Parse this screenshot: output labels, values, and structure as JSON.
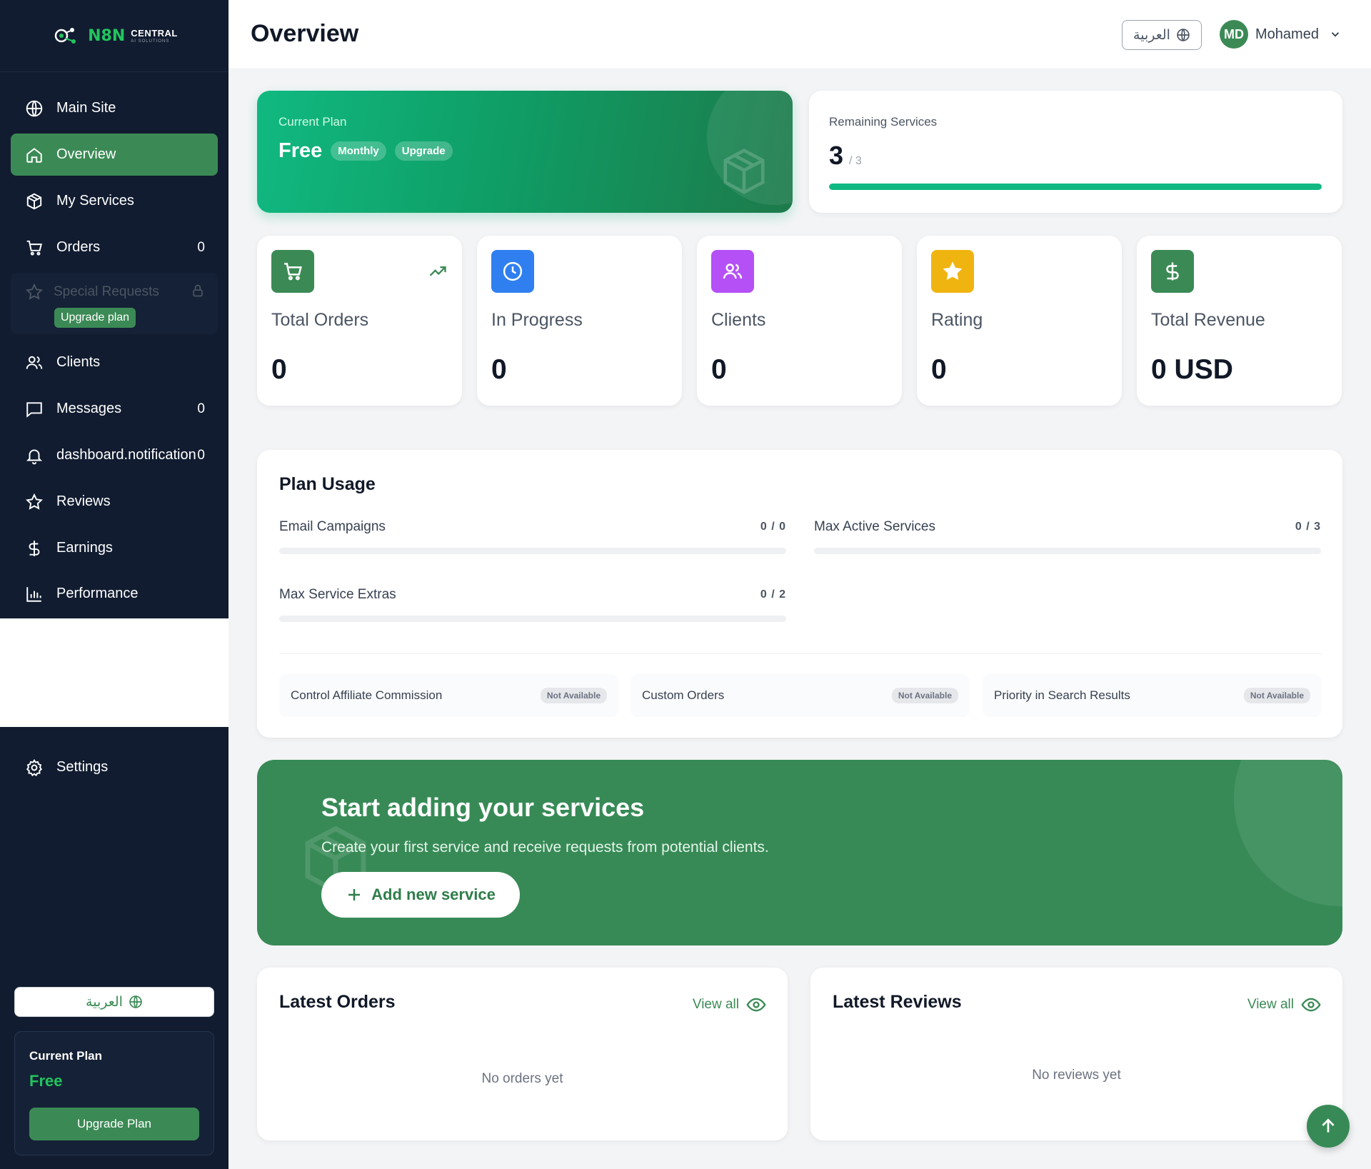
{
  "brand": {
    "name": "N8N",
    "sub": "CENTRAL",
    "tagline": "AI SOLUTIONS"
  },
  "header": {
    "title": "Overview",
    "lang_label": "العربية",
    "user_initials": "MD",
    "user_name": "Mohamed"
  },
  "sidebar": {
    "items": [
      {
        "label": "Main Site",
        "icon": "globe-icon"
      },
      {
        "label": "Overview",
        "icon": "home-icon",
        "active": true
      },
      {
        "label": "My Services",
        "icon": "box-icon"
      },
      {
        "label": "Orders",
        "icon": "cart-icon",
        "count": "0"
      },
      {
        "label": "Clients",
        "icon": "users-icon"
      },
      {
        "label": "Messages",
        "icon": "message-icon",
        "count": "0"
      },
      {
        "label": "dashboard.notification",
        "icon": "bell-icon",
        "count": "0"
      },
      {
        "label": "Reviews",
        "icon": "star-icon"
      },
      {
        "label": "Earnings",
        "icon": "dollar-icon"
      },
      {
        "label": "Performance",
        "icon": "chart-icon"
      }
    ],
    "special": {
      "label": "Special Requests",
      "upgrade_label": "Upgrade plan"
    },
    "settings_label": "Settings",
    "lang_label": "العربية",
    "plan": {
      "label": "Current Plan",
      "value": "Free",
      "button": "Upgrade Plan"
    }
  },
  "plan_card": {
    "label": "Current Plan",
    "plan": "Free",
    "cycle": "Monthly",
    "upgrade": "Upgrade"
  },
  "remaining": {
    "label": "Remaining Services",
    "value": "3",
    "total": "/ 3",
    "progress": 1.0
  },
  "stats": [
    {
      "label": "Total Orders",
      "value": "0",
      "icon": "cart-icon",
      "color": "#3b8a55"
    },
    {
      "label": "In Progress",
      "value": "0",
      "icon": "clock-icon",
      "color": "#2f7ff0"
    },
    {
      "label": "Clients",
      "value": "0",
      "icon": "users-icon",
      "color": "#b450f5"
    },
    {
      "label": "Rating",
      "value": "0",
      "icon": "star-icon",
      "color": "#f0b411"
    },
    {
      "label": "Total Revenue",
      "value": "0 USD",
      "icon": "dollar-icon",
      "color": "#3b8a55"
    }
  ],
  "plan_usage": {
    "title": "Plan Usage",
    "items": [
      {
        "label": "Email Campaigns",
        "count": "0 / 0"
      },
      {
        "label": "Max Active Services",
        "count": "0 / 3"
      },
      {
        "label": "Max Service Extras",
        "count": "0 / 2"
      }
    ],
    "features": [
      {
        "label": "Control Affiliate Commission",
        "status": "Not Available"
      },
      {
        "label": "Custom Orders",
        "status": "Not Available"
      },
      {
        "label": "Priority in Search Results",
        "status": "Not Available"
      }
    ]
  },
  "cta": {
    "title": "Start adding your services",
    "text": "Create your first service and receive requests from potential clients.",
    "button": "Add new service"
  },
  "latest_orders": {
    "title": "Latest Orders",
    "view_all": "View all",
    "empty": "No orders yet"
  },
  "latest_reviews": {
    "title": "Latest Reviews",
    "view_all": "View all",
    "empty": "No reviews yet"
  },
  "colors": {
    "sidebar_bg": "#111c30",
    "accent": "#3b8a55",
    "bright_green": "#10b981"
  }
}
